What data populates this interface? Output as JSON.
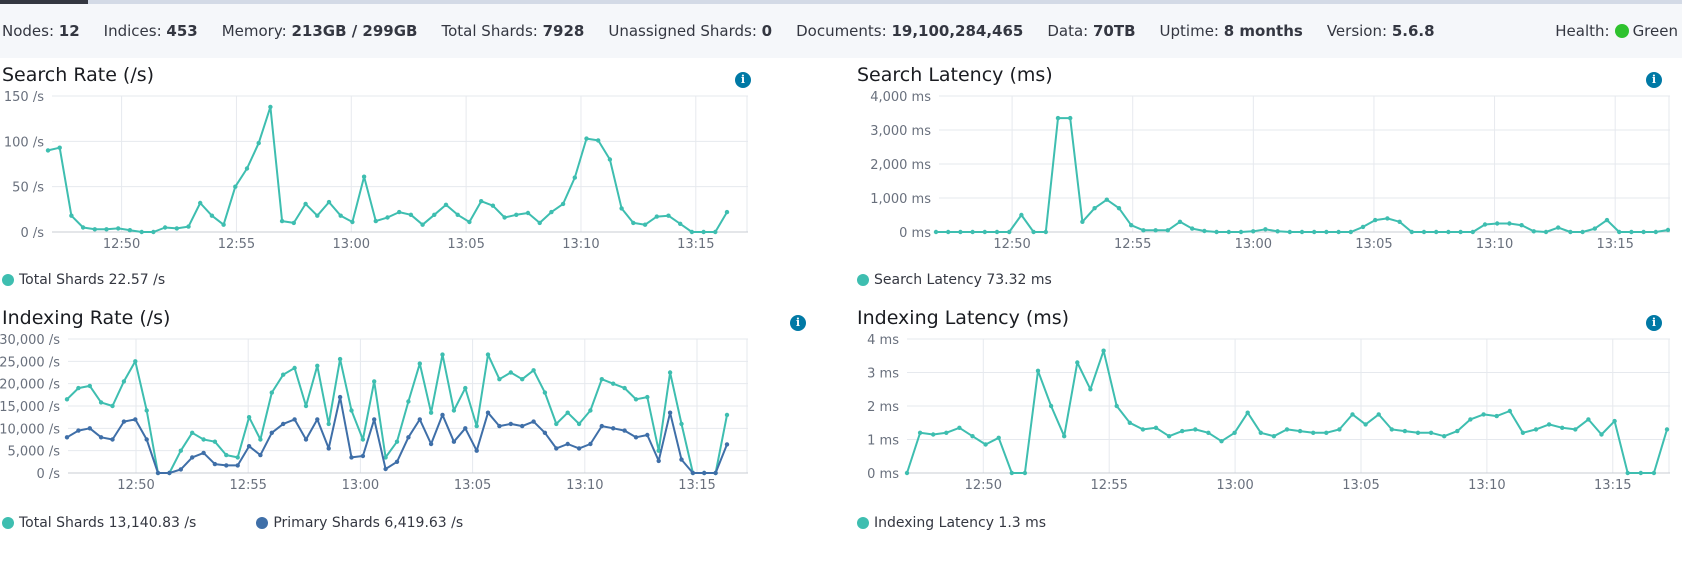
{
  "stats": [
    {
      "label": "Nodes: ",
      "value": "12"
    },
    {
      "label": "Indices: ",
      "value": "453"
    },
    {
      "label": "Memory: ",
      "value": "213GB / 299GB"
    },
    {
      "label": "Total Shards: ",
      "value": "7928"
    },
    {
      "label": "Unassigned Shards: ",
      "value": "0"
    },
    {
      "label": "Documents: ",
      "value": "19,100,284,465"
    },
    {
      "label": "Data: ",
      "value": "70TB"
    },
    {
      "label": "Uptime: ",
      "value": "8 months"
    },
    {
      "label": "Version: ",
      "value": "5.6.8"
    }
  ],
  "health": {
    "label": "Health:",
    "status": "Green",
    "color": "#2ec22e"
  },
  "colors": {
    "teal": "#3ebeb0",
    "blue": "#3f6fa8",
    "grid": "#e4e7ec",
    "info": "#0079a5"
  },
  "info_icon": "info-icon",
  "x_ticks": [
    "12:50",
    "12:55",
    "13:00",
    "13:05",
    "13:10",
    "13:15"
  ],
  "chart_data": [
    {
      "type": "line",
      "title": "Search Rate (/s)",
      "y_ticks": [
        "0 /s",
        "50 /s",
        "100 /s",
        "150 /s"
      ],
      "ylim": [
        0,
        150
      ],
      "series": [
        {
          "name": "Total Shards",
          "color": "#3ebeb0",
          "legend": "Total Shards 22.57 /s",
          "values": [
            90,
            93,
            18,
            5,
            3,
            3,
            4,
            2,
            0,
            0,
            5,
            4,
            6,
            32,
            18,
            8,
            50,
            70,
            98,
            138,
            12,
            10,
            31,
            18,
            33,
            18,
            11,
            61,
            12,
            16,
            22,
            19,
            8,
            19,
            30,
            19,
            11,
            34,
            29,
            16,
            19,
            21,
            10,
            22,
            31,
            60,
            103,
            101,
            80,
            26,
            10,
            8,
            17,
            18,
            9,
            0,
            0,
            0,
            22
          ]
        }
      ]
    },
    {
      "type": "line",
      "title": "Search Latency (ms)",
      "y_ticks": [
        "0 ms",
        "1,000 ms",
        "2,000 ms",
        "3,000 ms",
        "4,000 ms"
      ],
      "ylim": [
        0,
        4000
      ],
      "series": [
        {
          "name": "Search Latency",
          "color": "#3ebeb0",
          "legend": "Search Latency 73.32 ms",
          "values": [
            0,
            0,
            0,
            0,
            0,
            0,
            0,
            500,
            0,
            0,
            3350,
            3350,
            300,
            700,
            950,
            700,
            200,
            50,
            50,
            50,
            300,
            100,
            30,
            0,
            0,
            0,
            20,
            80,
            20,
            0,
            0,
            0,
            0,
            0,
            0,
            150,
            350,
            400,
            300,
            0,
            0,
            0,
            0,
            0,
            0,
            220,
            250,
            250,
            200,
            20,
            0,
            130,
            0,
            0,
            100,
            350,
            0,
            0,
            0,
            0,
            60
          ]
        }
      ]
    },
    {
      "type": "line",
      "title": "Indexing Rate (/s)",
      "y_ticks": [
        "0 /s",
        "5,000 /s",
        "10,000 /s",
        "15,000 /s",
        "20,000 /s",
        "25,000 /s",
        "30,000 /s"
      ],
      "ylim": [
        0,
        30000
      ],
      "series": [
        {
          "name": "Total Shards",
          "color": "#3ebeb0",
          "legend": "Total Shards 13,140.83 /s",
          "values": [
            16500,
            19000,
            19500,
            15800,
            15000,
            20500,
            25000,
            14000,
            0,
            0,
            5000,
            9000,
            7500,
            7000,
            4000,
            3500,
            12500,
            7500,
            18000,
            22000,
            23500,
            15000,
            24000,
            11000,
            25500,
            14000,
            7500,
            20500,
            3500,
            7000,
            16000,
            24500,
            13500,
            26500,
            14000,
            19000,
            10500,
            26500,
            21000,
            22500,
            21000,
            23000,
            18000,
            11000,
            13500,
            11000,
            14000,
            21000,
            20000,
            19000,
            16500,
            17000,
            5000,
            22500,
            11000,
            0,
            0,
            0,
            13000
          ]
        },
        {
          "name": "Primary Shards",
          "color": "#3f6fa8",
          "legend": "Primary Shards 6,419.63 /s",
          "values": [
            8000,
            9500,
            10000,
            8000,
            7500,
            11500,
            12000,
            7500,
            0,
            0,
            800,
            3500,
            4500,
            2000,
            1700,
            1700,
            6000,
            4000,
            9000,
            11000,
            12000,
            7500,
            12000,
            5500,
            17000,
            3500,
            3800,
            12000,
            900,
            2500,
            8000,
            12000,
            6500,
            13000,
            7000,
            10000,
            5000,
            13500,
            10500,
            11000,
            10500,
            11500,
            9000,
            5500,
            6500,
            5500,
            6500,
            10500,
            10000,
            9500,
            8000,
            8500,
            2700,
            13500,
            3000,
            0,
            0,
            0,
            6400
          ]
        }
      ]
    },
    {
      "type": "line",
      "title": "Indexing Latency (ms)",
      "y_ticks": [
        "0 ms",
        "1 ms",
        "2 ms",
        "3 ms",
        "4 ms"
      ],
      "ylim": [
        0,
        4
      ],
      "series": [
        {
          "name": "Indexing Latency",
          "color": "#3ebeb0",
          "legend": "Indexing Latency 1.3 ms",
          "values": [
            0,
            1.2,
            1.15,
            1.2,
            1.35,
            1.1,
            0.85,
            1.05,
            0,
            0,
            3.05,
            2,
            1.1,
            3.3,
            2.5,
            3.65,
            2,
            1.5,
            1.3,
            1.35,
            1.1,
            1.25,
            1.3,
            1.2,
            0.95,
            1.2,
            1.8,
            1.2,
            1.1,
            1.3,
            1.25,
            1.2,
            1.2,
            1.3,
            1.75,
            1.45,
            1.75,
            1.3,
            1.25,
            1.2,
            1.2,
            1.1,
            1.25,
            1.6,
            1.75,
            1.7,
            1.85,
            1.2,
            1.3,
            1.45,
            1.35,
            1.3,
            1.6,
            1.15,
            1.55,
            0,
            0,
            0,
            1.3
          ]
        }
      ]
    }
  ]
}
